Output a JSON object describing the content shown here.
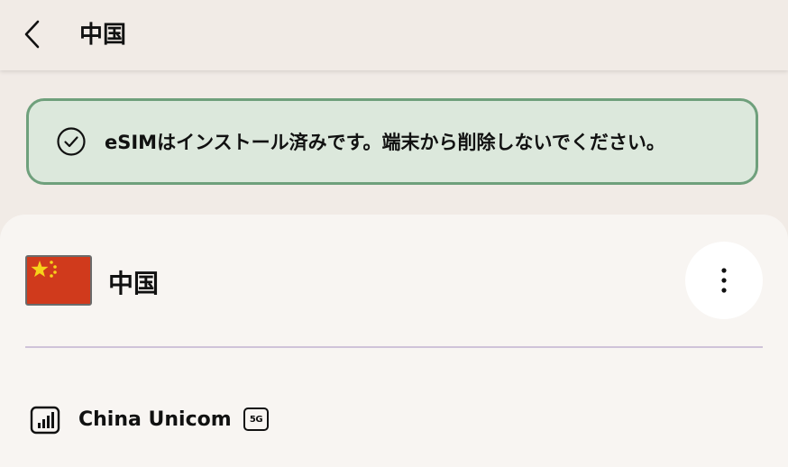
{
  "header": {
    "title": "中国",
    "back_icon": "chevron-left-icon"
  },
  "banner": {
    "icon": "check-circle-icon",
    "message": "eSIMはインストール済みです。端末から削除しないでください。",
    "colors": {
      "background": "#dce8dc",
      "border": "#6fa07c"
    }
  },
  "country_card": {
    "flag_icon": "china-flag-icon",
    "country_name": "中国",
    "more_icon": "more-vertical-icon"
  },
  "network": {
    "signal_icon": "signal-icon",
    "carrier_name": "China Unicom",
    "network_type": "5G"
  }
}
